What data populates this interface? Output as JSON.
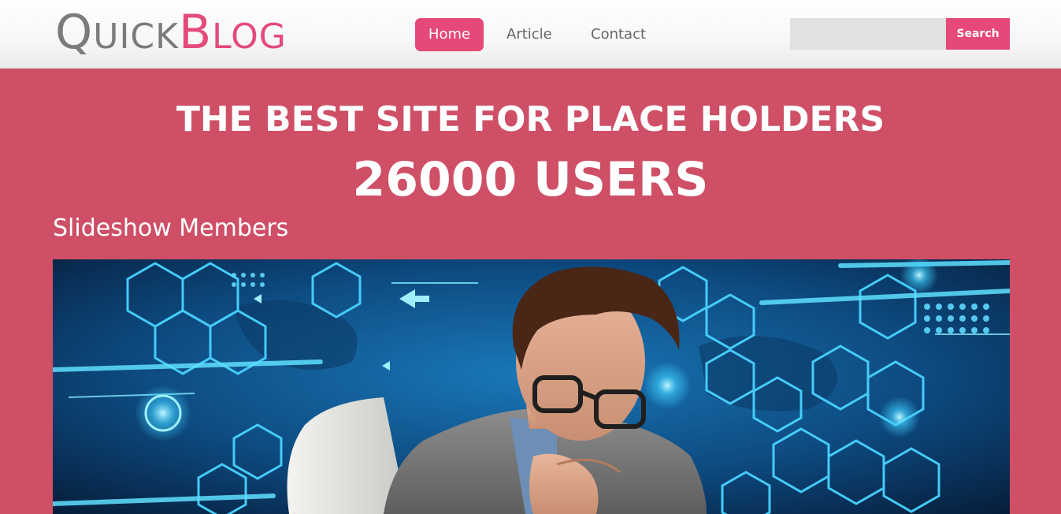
{
  "header": {
    "logo": {
      "quick_first": "Q",
      "quick_rest": "UICK",
      "blog_first": "B",
      "blog_rest": "LOG"
    },
    "nav": {
      "home": "Home",
      "article": "Article",
      "contact": "Contact"
    },
    "search": {
      "value": "",
      "button_label": "Search"
    }
  },
  "hero": {
    "title": "THE BEST SITE FOR PLACE HOLDERS",
    "count": "26000 USERS"
  },
  "slideshow": {
    "title": "Slideshow Members"
  },
  "colors": {
    "accent": "#e64878",
    "hero_bg": "#ce4f66",
    "logo_gray": "#7b7b7b"
  }
}
